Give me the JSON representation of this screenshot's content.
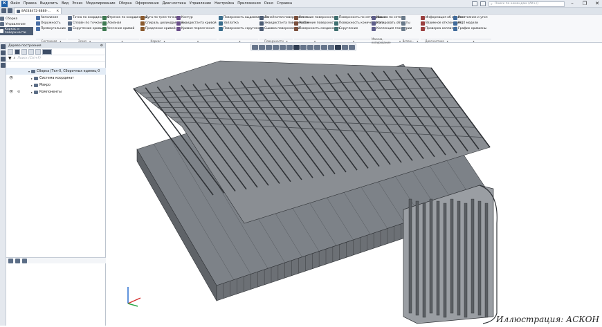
{
  "titlebar": {
    "menu": [
      "Файл",
      "Правка",
      "Выделить",
      "Вид",
      "Эскиз",
      "Моделирование",
      "Сборка",
      "Оформление",
      "Диагностика",
      "Управление",
      "Настройка",
      "Приложения",
      "Окно",
      "Справка"
    ],
    "search_placeholder": "Поиск по командам (Alt+/)"
  },
  "tabbar": {
    "doc_tab": "8AE48472-8888-..."
  },
  "ribbon": {
    "left_items": [
      "Сборка",
      "Управление",
      "Каркас и поверхности"
    ],
    "groups": [
      {
        "items": [
          "Автолиния",
          "Окружность",
          "Прямоугольник"
        ],
        "footer": "Системная"
      },
      {
        "items": [
          "Точка по координатам",
          "Сплайн по точкам",
          "Скругление кривых"
        ],
        "footer": "Эскиз"
      },
      {
        "items": [
          "Отрезок по координатам",
          "Ломаная",
          "Усечение кривой"
        ],
        "footer": ""
      },
      {
        "items": [
          "Дуга по трем точкам",
          "Спираль цилиндрическ...",
          "Продление кривой"
        ],
        "footer": "Каркас"
      },
      {
        "items": [
          "Контур",
          "Эквидистанта кривой",
          "Кривая пересечения"
        ],
        "footer": ""
      },
      {
        "items": [
          "Поверхность выдавливания",
          "Заплатка",
          "Поверхность скругления"
        ],
        "footer": ""
      },
      {
        "items": [
          "Линейчатая поверхность п...",
          "Эквидистанта поверхности",
          "Сшивка поверхностей"
        ],
        "footer": "Поверхности"
      },
      {
        "items": [
          "Усечение поверхности",
          "Разбиение поверхности",
          "Поверхность соединения"
        ],
        "footer": ""
      },
      {
        "items": [
          "Поверхность по сети кривых",
          "Поверхность конического с...",
          "Скругление"
        ],
        "footer": ""
      },
      {
        "items": [
          "Массив по сетке",
          "Копировать объекты",
          "Коллекция геометрии"
        ],
        "footer": "Массив, копирование"
      },
      {
        "items": [
          "",
          "",
          ""
        ],
        "footer": "Вспом..."
      },
      {
        "items": [
          "Информация об объекте",
          "Взаимное отклонение",
          "Проверка коллизий"
        ],
        "footer": "Диагностика"
      },
      {
        "items": [
          "Расстояние и угол",
          "МЦХ модели",
          "График кривизны"
        ],
        "footer": ""
      }
    ]
  },
  "panel": {
    "title": "Дерево построения",
    "search_placeholder": "Поиск (Ctrl+F)",
    "tree": [
      {
        "label": "Сборка (Тел-0, Сборочных единиц-0",
        "indent": 0
      },
      {
        "label": "Система координат",
        "indent": 1
      },
      {
        "label": "Макро",
        "indent": 1
      },
      {
        "label": "Компоненты",
        "indent": 1
      }
    ]
  },
  "viewport": {
    "credit": "Иллюстрация: АСКОН"
  },
  "colors": {
    "accent": "#1d5fa8",
    "model": "#5a5e63",
    "panel": "#f7f8fa"
  }
}
